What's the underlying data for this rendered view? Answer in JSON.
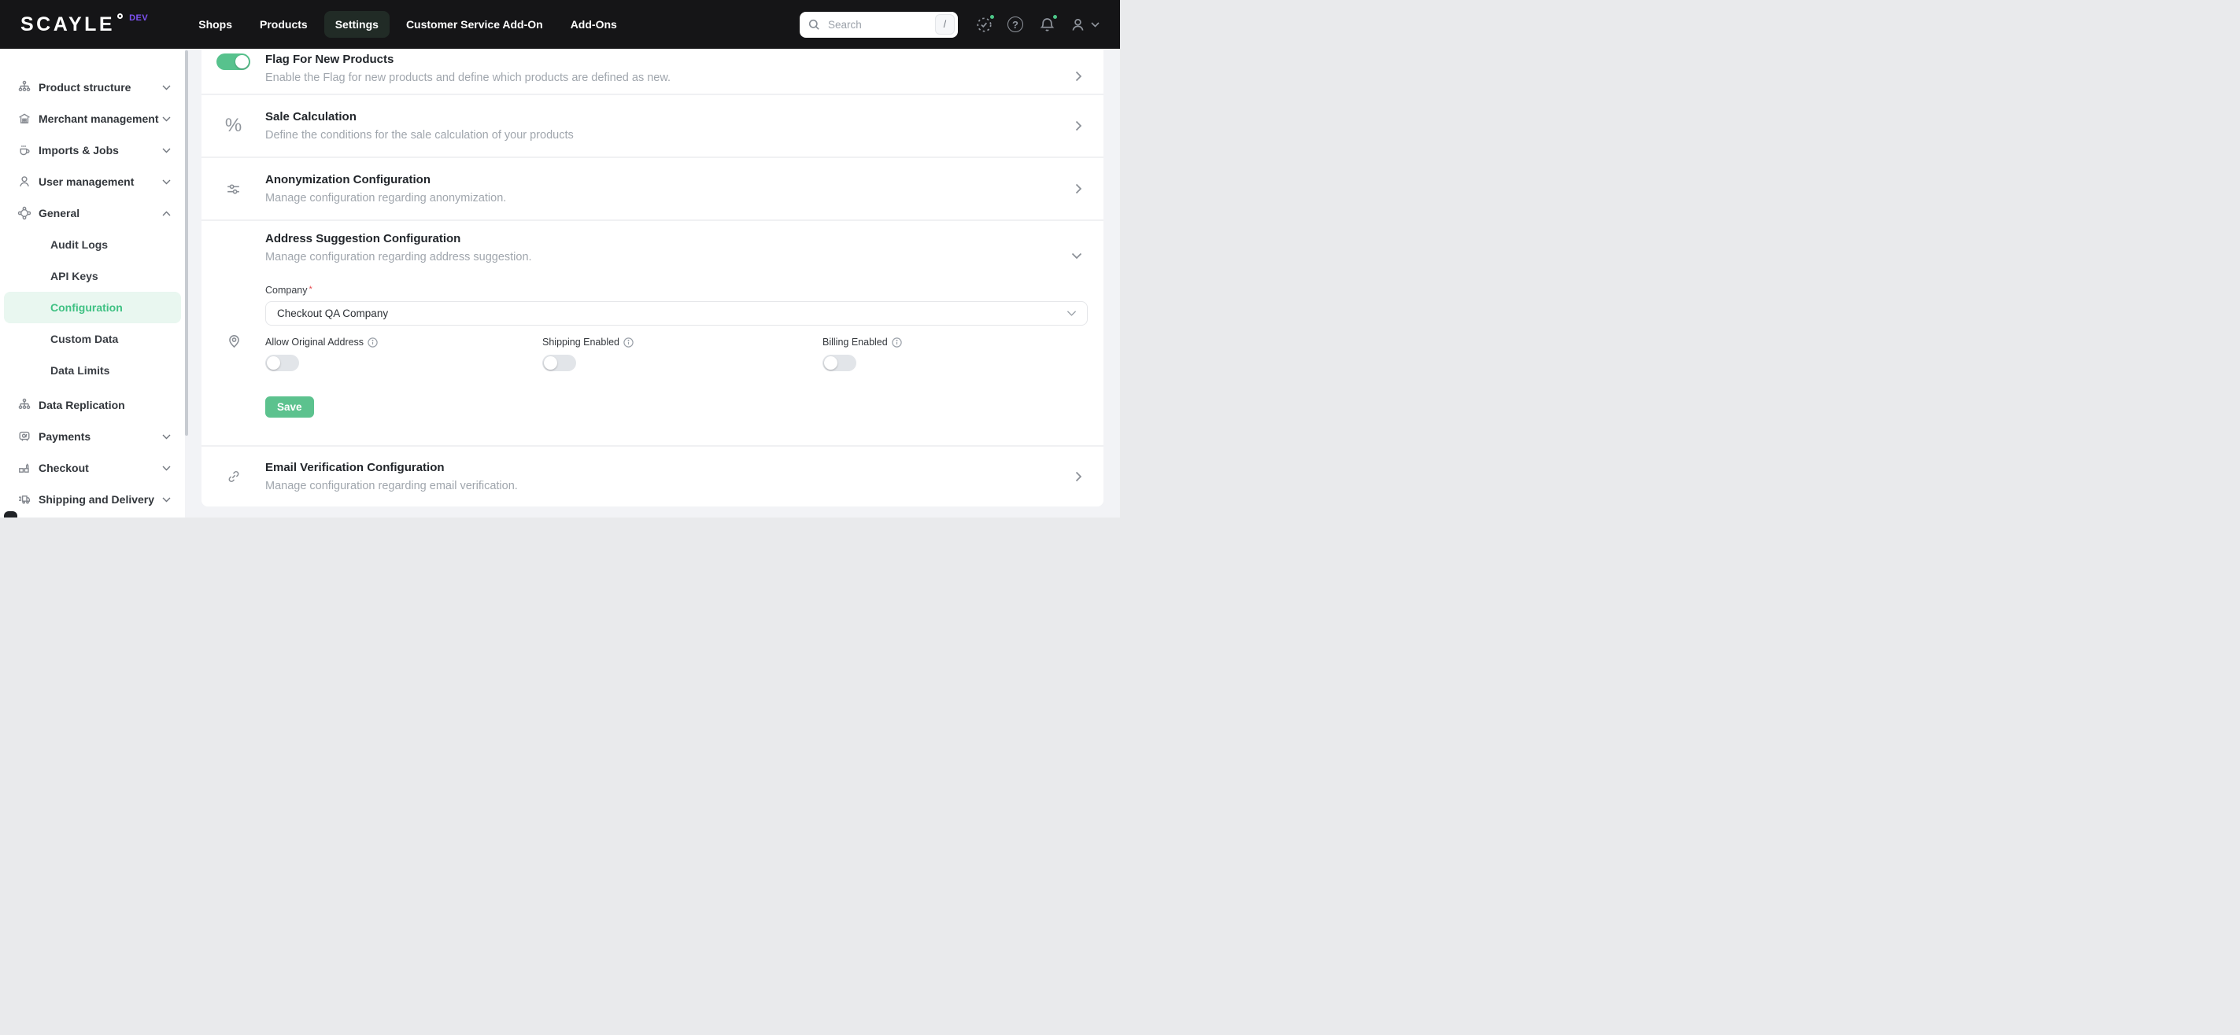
{
  "topbar": {
    "logo": "SCAYLE",
    "env_badge": "DEV",
    "nav": [
      {
        "label": "Shops",
        "active": false
      },
      {
        "label": "Products",
        "active": false
      },
      {
        "label": "Settings",
        "active": true
      },
      {
        "label": "Customer Service Add-On",
        "active": false
      },
      {
        "label": "Add-Ons",
        "active": false
      }
    ],
    "search": {
      "placeholder": "Search",
      "shortcut": "/"
    }
  },
  "sidebar": {
    "items": [
      {
        "label": "Product structure",
        "chevron": "down"
      },
      {
        "label": "Merchant management",
        "chevron": "down"
      },
      {
        "label": "Imports & Jobs",
        "chevron": "down"
      },
      {
        "label": "User management",
        "chevron": "down"
      },
      {
        "label": "General",
        "chevron": "up",
        "expanded": true
      },
      {
        "label": "Data Replication",
        "chevron": "none"
      },
      {
        "label": "Payments",
        "chevron": "down"
      },
      {
        "label": "Checkout",
        "chevron": "down"
      },
      {
        "label": "Shipping and Delivery",
        "chevron": "down"
      }
    ],
    "general_children": [
      {
        "label": "Audit Logs",
        "active": false
      },
      {
        "label": "API Keys",
        "active": false
      },
      {
        "label": "Configuration",
        "active": true
      },
      {
        "label": "Custom Data",
        "active": false
      },
      {
        "label": "Data Limits",
        "active": false
      }
    ]
  },
  "content": {
    "rows": [
      {
        "title": "Flag For New Products",
        "description": "Enable the Flag for new products and define which products are defined as new.",
        "toggle_state": "on"
      },
      {
        "title": "Sale Calculation",
        "description": "Define the conditions for the sale calculation of your products"
      },
      {
        "title": "Anonymization Configuration",
        "description": "Manage configuration regarding anonymization."
      },
      {
        "title": "Address Suggestion Configuration",
        "description": "Manage configuration regarding address suggestion.",
        "expanded": true
      },
      {
        "title": "Email Verification Configuration",
        "description": "Manage configuration regarding email verification."
      }
    ],
    "address_form": {
      "company_label": "Company",
      "required_mark": "*",
      "company_value": "Checkout QA Company",
      "toggles": [
        {
          "label": "Allow Original Address",
          "state": "off"
        },
        {
          "label": "Shipping Enabled",
          "state": "off"
        },
        {
          "label": "Billing Enabled",
          "state": "off"
        }
      ],
      "save_label": "Save"
    }
  },
  "icons": {
    "search": "magnifier",
    "status": "dotted-circle-check",
    "help": "question-circle",
    "notifications": "bell",
    "account": "person",
    "row_sale": "percent",
    "row_anonymization": "sliders",
    "row_address": "location-pin",
    "row_email": "link"
  },
  "colors": {
    "topbar_bg": "#151517",
    "accent_green": "#57c28d",
    "env_badge": "#7e52f5",
    "active_nav_bg": "#212b26",
    "active_sidebar_bg": "#e9f7f0",
    "active_sidebar_text": "#3fc183",
    "notification_dot": "#4cc688",
    "required_red": "#e5484d"
  }
}
